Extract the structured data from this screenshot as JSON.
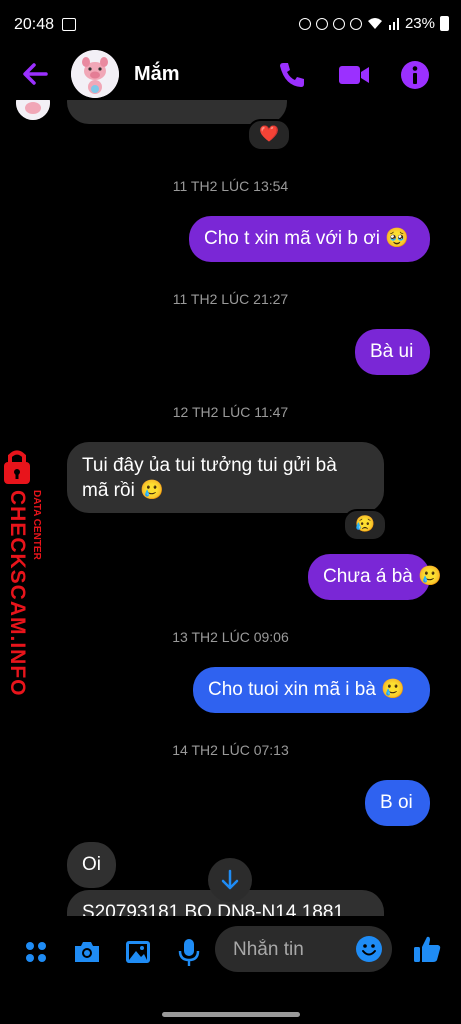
{
  "status": {
    "time": "20:48",
    "battery": "23%"
  },
  "header": {
    "name": "Mắm"
  },
  "messages": {
    "reaction_heart": "❤️",
    "stamp1": "11 TH2 LÚC 13:54",
    "m1": "Cho t xin mã với b ơi 🥹",
    "stamp2": "11 TH2 LÚC 21:27",
    "m2": "Bà ui",
    "stamp3": "12 TH2 LÚC 11:47",
    "m3_line1": "Tui đây ủa tui tưởng tui gửi bà",
    "m3_line2": "mã rồi 🥲",
    "reaction_sad": "😥",
    "m4": "Chưa á bà 🥲",
    "stamp4": "13 TH2 LÚC 09:06",
    "m5": "Cho tuoi xin mã i bà 🥲",
    "stamp5": "14 TH2 LÚC 07:13",
    "m6": "B oi",
    "m7": "Oi",
    "m8": "S20793181 BO DN8-N14 1881"
  },
  "watermark": {
    "line1": "CHECKSCAM.INFO",
    "line2": "DATA CENTER"
  },
  "composer": {
    "placeholder": "Nhắn tin"
  },
  "colors": {
    "accent": "#9b30ff",
    "purple_bubble": "#7a27d6",
    "blue_bubble": "#2f62f0",
    "incoming": "#303030",
    "icon_blue": "#1f8cf5"
  }
}
